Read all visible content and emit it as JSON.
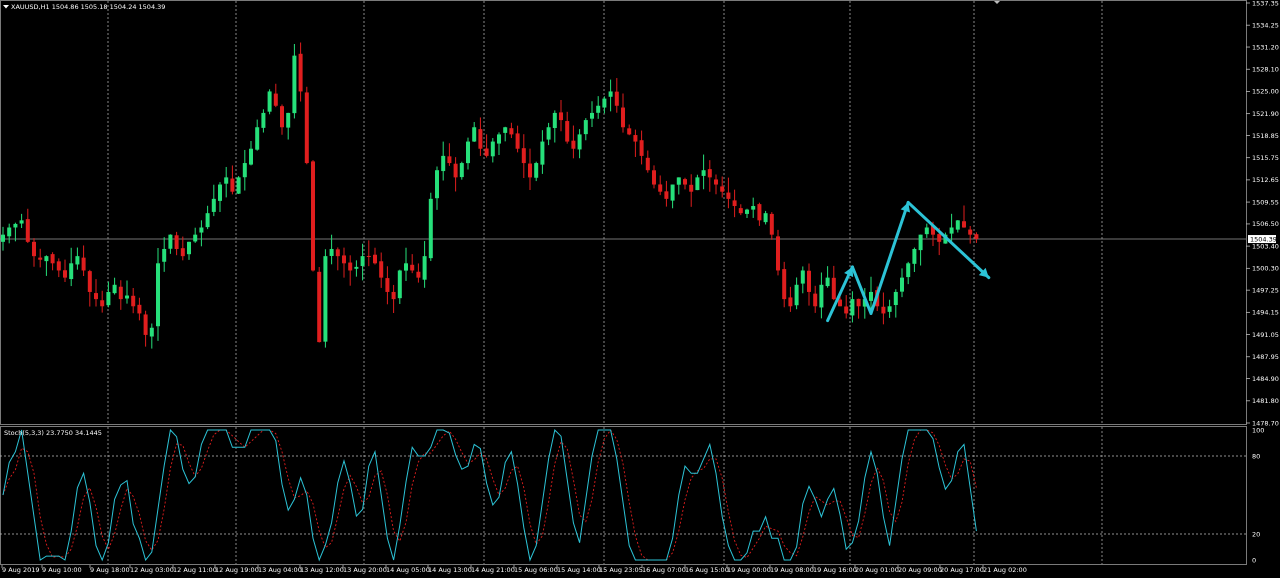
{
  "header": {
    "symbol_line": "XAUUSD,H1  1504.86 1505.18 1504.24 1504.39"
  },
  "indicator": {
    "label": "Stoch(5,3,3) 23.7750 34.1445"
  },
  "colors": {
    "background": "#000000",
    "bull": "#26e07a",
    "bear": "#e01e1e",
    "grid": "#bfbfbf",
    "price_line": "#9a9a9a",
    "arrow": "#2cc3d6",
    "stoch_main": "#2cc3d6",
    "stoch_signal": "#e01e1e",
    "axis_text": "#ffffff"
  },
  "chart_data": {
    "type": "candlestick",
    "price_axis": {
      "range": [
        1478.7,
        1537.35
      ],
      "ticks": [
        "1537.35",
        "1534.25",
        "1531.20",
        "1528.10",
        "1525.00",
        "1521.90",
        "1518.85",
        "1515.75",
        "1512.65",
        "1509.55",
        "1506.50",
        "1503.40",
        "1500.30",
        "1497.25",
        "1494.15",
        "1491.05",
        "1487.95",
        "1484.90",
        "1481.80",
        "1478.70"
      ],
      "current_price": "1504.39"
    },
    "time_axis": {
      "labels": [
        "9 Aug 2019",
        "9 Aug 10:00",
        "9 Aug 18:00",
        "12 Aug 03:00",
        "12 Aug 11:00",
        "12 Aug 19:00",
        "13 Aug 04:00",
        "13 Aug 12:00",
        "13 Aug 20:00",
        "14 Aug 05:00",
        "14 Aug 13:00",
        "14 Aug 21:00",
        "15 Aug 06:00",
        "15 Aug 14:00",
        "15 Aug 23:05",
        "16 Aug 07:00",
        "16 Aug 15:00",
        "19 Aug 00:00",
        "19 Aug 08:00",
        "19 Aug 16:00",
        "20 Aug 01:00",
        "20 Aug 09:00",
        "20 Aug 17:00",
        "21 Aug 02:00"
      ]
    },
    "candles_close": [
      1505,
      1506,
      1506.5,
      1507,
      1504,
      1502,
      1501.5,
      1502,
      1501,
      1500,
      1499,
      1501,
      1502,
      1500,
      1497,
      1496,
      1495,
      1497,
      1498,
      1496,
      1496.5,
      1495,
      1494,
      1491,
      1492,
      1501,
      1503,
      1505,
      1503,
      1502,
      1504,
      1505,
      1506,
      1508,
      1510,
      1512,
      1513,
      1511,
      1513,
      1515,
      1517,
      1520,
      1522,
      1525,
      1523,
      1520,
      1522,
      1530,
      1525,
      1515,
      1500,
      1490,
      1502,
      1503,
      1502,
      1501,
      1500,
      1500.5,
      1502,
      1502,
      1501,
      1499,
      1497,
      1496,
      1500,
      1501,
      1500,
      1499,
      1502,
      1510,
      1514,
      1516,
      1515,
      1513,
      1515,
      1518,
      1520,
      1517,
      1516,
      1518,
      1519,
      1520,
      1519,
      1517,
      1515,
      1513,
      1515,
      1518,
      1520,
      1522,
      1521,
      1518,
      1517,
      1519,
      1521,
      1522,
      1523,
      1524,
      1525,
      1523,
      1520,
      1519,
      1518,
      1516,
      1514,
      1512,
      1511,
      1510,
      1512,
      1513,
      1512,
      1511,
      1513,
      1514,
      1513,
      1512,
      1511,
      1510,
      1509,
      1508,
      1508.5,
      1509,
      1507,
      1508,
      1505,
      1500,
      1496,
      1495,
      1498,
      1500,
      1497,
      1495,
      1498,
      1499,
      1496,
      1495,
      1494,
      1496,
      1495,
      1496,
      1497,
      1495,
      1494,
      1495,
      1497,
      1499,
      1501,
      1503,
      1505,
      1506,
      1505,
      1504,
      1505,
      1506,
      1507,
      1506,
      1505,
      1504.4
    ],
    "stochastic": {
      "range": [
        0,
        100
      ],
      "levels": [
        20,
        80
      ],
      "axis_ticks": [
        "100",
        "80",
        "20",
        "0"
      ]
    },
    "annotations": [
      {
        "type": "arrow",
        "from_time_index": 133,
        "from_price": 1493,
        "to_time_index": 137,
        "to_price": 1500.5
      },
      {
        "type": "line",
        "from_time_index": 137,
        "from_price": 1500.5,
        "to_time_index": 140,
        "to_price": 1494
      },
      {
        "type": "arrow",
        "from_time_index": 140,
        "from_price": 1494,
        "to_time_index": 146,
        "to_price": 1509.5
      },
      {
        "type": "arrow",
        "from_time_index": 146,
        "from_price": 1509.5,
        "to_time_index": 159,
        "to_price": 1499
      }
    ]
  }
}
